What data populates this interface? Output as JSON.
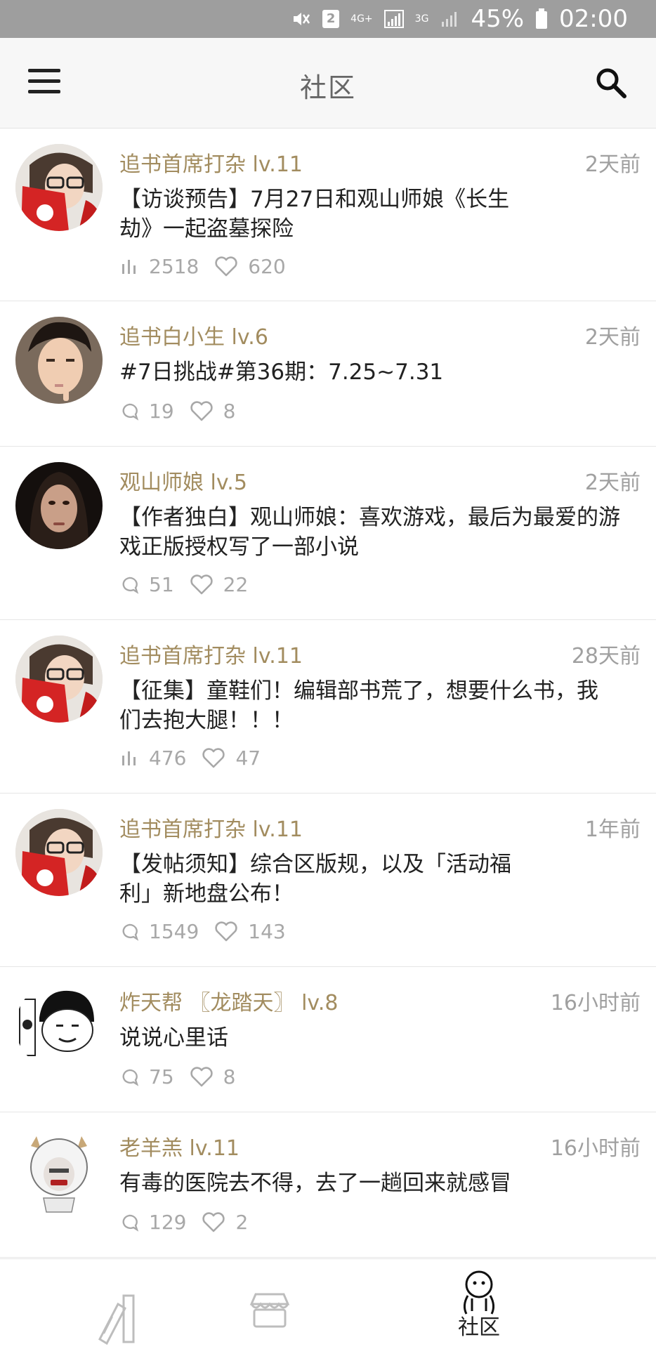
{
  "status_bar": {
    "sim_badge": "2",
    "net_4g": "4G+",
    "net_3g": "3G",
    "battery": "45%",
    "time": "02:00",
    "icons": [
      "mute-vibrate-icon",
      "sim-2-icon",
      "signal-icon",
      "battery-icon"
    ]
  },
  "app_bar": {
    "title": "社区",
    "menu_icon": "hamburger-menu-icon",
    "search_icon": "search-icon"
  },
  "colors": {
    "username": "#a28c5f",
    "time": "#a0a0a0",
    "stats": "#a8a8a8",
    "status_bar": "#9e9e9e"
  },
  "posts": [
    {
      "user": "追书首席打杂 lv.11",
      "time": "2天前",
      "text": "【访谈预告】7月27日和观山师娘《长生劫》一起盗墓探险",
      "stat_type": "views",
      "count": "2518",
      "likes": "620"
    },
    {
      "user": "追书白小生 lv.6",
      "time": "2天前",
      "text": "#7日挑战#第36期：7.25~7.31",
      "stat_type": "comments",
      "count": "19",
      "likes": "8"
    },
    {
      "user": "观山师娘 lv.5",
      "time": "2天前",
      "text": "【作者独白】观山师娘：喜欢游戏，最后为最爱的游戏正版授权写了一部小说",
      "stat_type": "comments",
      "count": "51",
      "likes": "22"
    },
    {
      "user": "追书首席打杂 lv.11",
      "time": "28天前",
      "text": "【征集】童鞋们！编辑部书荒了，想要什么书，我们去抱大腿！！！",
      "stat_type": "views",
      "count": "476",
      "likes": "47"
    },
    {
      "user": "追书首席打杂 lv.11",
      "time": "1年前",
      "text": "【发帖须知】综合区版规，以及「活动福利」新地盘公布！",
      "stat_type": "comments",
      "count": "1549",
      "likes": "143"
    },
    {
      "user": "炸天帮 〖龙踏天〗 lv.8",
      "time": "16小时前",
      "text": "说说心里话",
      "stat_type": "comments",
      "count": "75",
      "likes": "8"
    },
    {
      "user": "老羊羔 lv.11",
      "time": "16小时前",
      "text": "有毒的医院去不得，去了一趟回来就感冒",
      "stat_type": "comments",
      "count": "129",
      "likes": "2"
    }
  ],
  "bottom_nav": {
    "items": [
      {
        "icon": "bookshelf-icon"
      },
      {
        "icon": "store-icon"
      },
      {
        "icon": "community-icon",
        "label": "社区",
        "active": true
      }
    ]
  }
}
